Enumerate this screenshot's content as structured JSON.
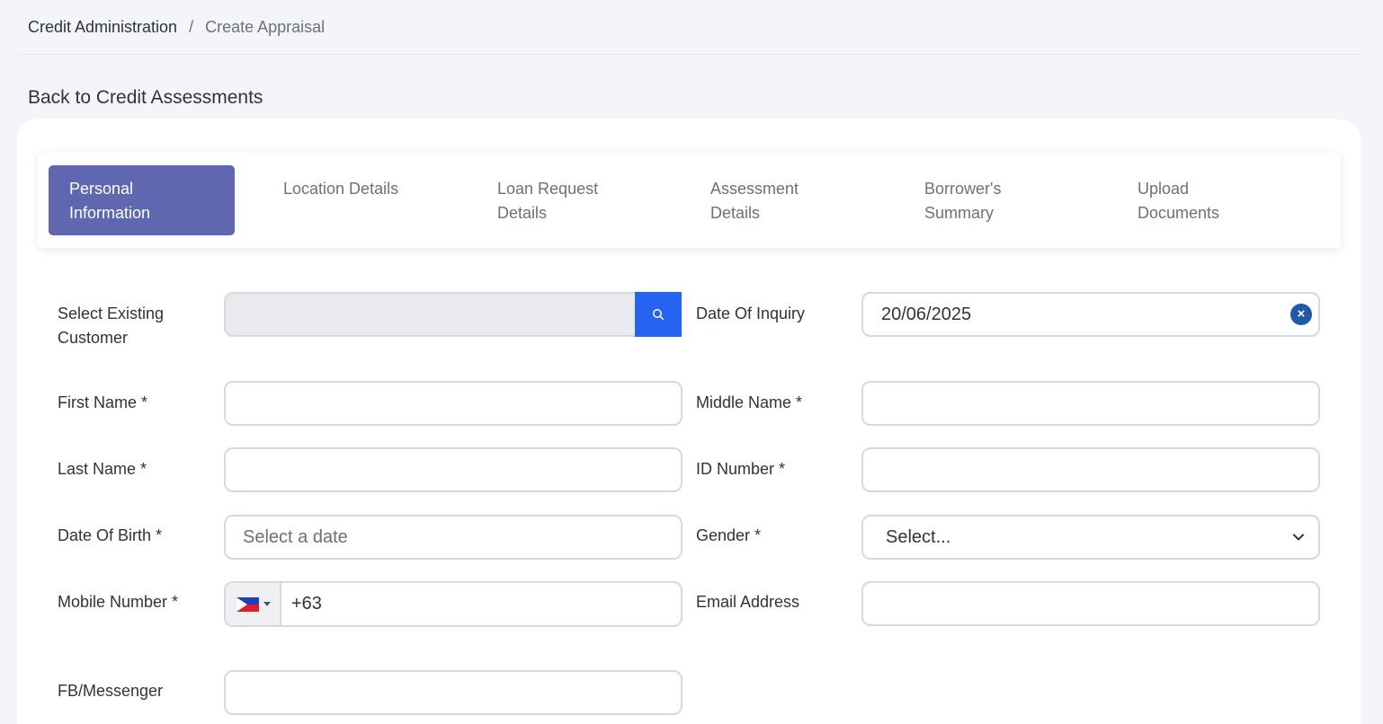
{
  "breadcrumb": {
    "parent": "Credit Administration",
    "separator": "/",
    "current": "Create Appraisal"
  },
  "back_link": "Back to Credit Assessments",
  "tabs": [
    {
      "label": "Personal Information",
      "active": true
    },
    {
      "label": "Location Details",
      "active": false
    },
    {
      "label": "Loan Request Details",
      "active": false
    },
    {
      "label": "Assessment Details",
      "active": false
    },
    {
      "label": "Borrower's Summary",
      "active": false
    },
    {
      "label": "Upload Documents",
      "active": false
    }
  ],
  "form": {
    "select_existing_customer": {
      "label": "Select Existing Customer",
      "value": ""
    },
    "date_of_inquiry": {
      "label": "Date Of Inquiry",
      "value": "20/06/2025"
    },
    "first_name": {
      "label": "First Name *",
      "value": ""
    },
    "middle_name": {
      "label": "Middle Name *",
      "value": ""
    },
    "last_name": {
      "label": "Last Name *",
      "value": ""
    },
    "id_number": {
      "label": "ID Number *",
      "value": ""
    },
    "date_of_birth": {
      "label": "Date Of Birth *",
      "placeholder": "Select a date"
    },
    "gender": {
      "label": "Gender *",
      "value": "Select..."
    },
    "mobile_number": {
      "label": "Mobile Number *",
      "value": "+63"
    },
    "email_address": {
      "label": "Email Address",
      "value": ""
    },
    "fb_messenger": {
      "label": "FB/Messenger",
      "value": ""
    }
  },
  "icons": {
    "search": "search-icon",
    "clear": "clear-icon",
    "chevron": "chevron-down-icon",
    "flag": "philippines-flag-icon"
  },
  "colors": {
    "active_tab": "#5e67b0",
    "search_button": "#2563f0",
    "clear_button": "#1e5aa8",
    "page_background": "#f3f5f9"
  }
}
